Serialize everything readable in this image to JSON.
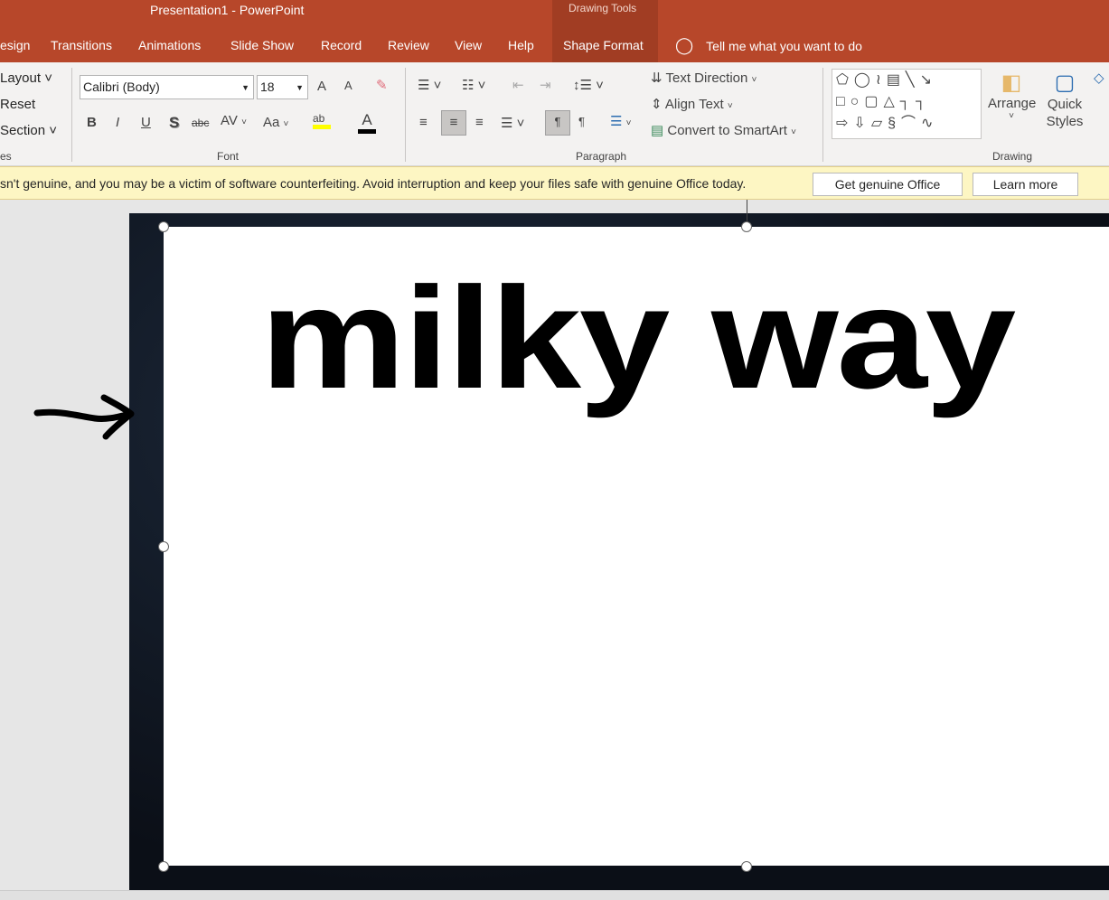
{
  "window": {
    "title": "Presentation1  -  PowerPoint",
    "contextual_tab_group": "Drawing Tools"
  },
  "tabs": [
    {
      "label": "esign"
    },
    {
      "label": "Transitions"
    },
    {
      "label": "Animations"
    },
    {
      "label": "Slide Show"
    },
    {
      "label": "Record"
    },
    {
      "label": "Review"
    },
    {
      "label": "View"
    },
    {
      "label": "Help"
    },
    {
      "label": "Shape Format",
      "active": true
    }
  ],
  "tell_me": "Tell me what you want to do",
  "ribbon": {
    "slides": {
      "layout": "Layout",
      "reset": "Reset",
      "section": "Section",
      "group": "es"
    },
    "font": {
      "name": "Calibri (Body)",
      "size": "18",
      "bold": "B",
      "italic": "I",
      "underline": "U",
      "shadow": "S",
      "strike": "abc",
      "spacing": "AV",
      "case": "Aa",
      "grow": "A",
      "shrink": "A",
      "highlight_color": "#ffff00",
      "font_color": "#000000",
      "group": "Font"
    },
    "paragraph": {
      "text_direction": "Text Direction",
      "align_text": "Align Text",
      "smartart": "Convert to SmartArt",
      "group": "Paragraph",
      "alignment": "center"
    },
    "drawing": {
      "arrange": "Arrange",
      "quick_styles": "Quick Styles",
      "group": "Drawing"
    }
  },
  "notice": {
    "text": "sn't genuine, and you may be a victim of software counterfeiting. Avoid interruption and keep your files safe with genuine Office today.",
    "get_genuine": "Get genuine Office",
    "learn_more": "Learn more"
  },
  "slide": {
    "text": "milky way"
  },
  "colors": {
    "titlebar": "#b7472a",
    "ribbon": "#f3f2f1",
    "notice": "#fdf6c3"
  }
}
